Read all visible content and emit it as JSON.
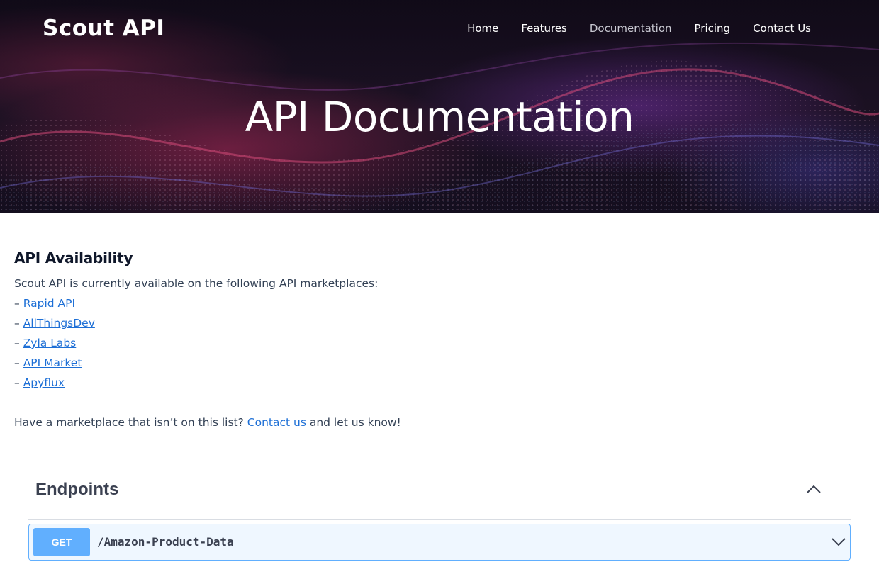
{
  "header": {
    "logo_text": "Scout API",
    "nav": [
      {
        "label": "Home"
      },
      {
        "label": "Features"
      },
      {
        "label": "Documentation"
      },
      {
        "label": "Pricing"
      },
      {
        "label": "Contact Us"
      }
    ],
    "active_nav": "Documentation"
  },
  "hero": {
    "title": "API Documentation"
  },
  "availability": {
    "title": "API Availability",
    "intro": "Scout API is currently available on the following API marketplaces:",
    "bullet": "– ",
    "marketplaces": [
      {
        "label": "Rapid API"
      },
      {
        "label": "AllThingsDev"
      },
      {
        "label": "Zyla Labs"
      },
      {
        "label": "API Market"
      },
      {
        "label": "Apyflux"
      }
    ],
    "footer_prefix": "Have a marketplace that isn’t on this list? ",
    "footer_link": "Contact us",
    "footer_suffix": " and let us know!"
  },
  "endpoints": {
    "title": "Endpoints",
    "operations": [
      {
        "method": "GET",
        "path": "/Amazon-Product-Data"
      }
    ]
  },
  "colors": {
    "link": "#1d6fd6",
    "get_method": "#61affe",
    "heading": "#0f172a",
    "body_text": "#334155"
  },
  "icons": {
    "collapse": "chevron-up-icon",
    "expand": "chevron-down-icon"
  }
}
